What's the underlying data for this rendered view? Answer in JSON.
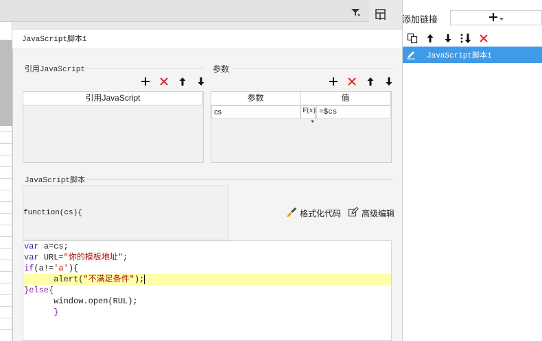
{
  "right_panel": {
    "title": "添加链接",
    "add_symbol": "+",
    "items": [
      {
        "label": "JavaScript脚本1",
        "selected": true
      }
    ]
  },
  "dialog": {
    "title": "JavaScript脚本1",
    "ref_section": {
      "label": "引用JavaScript",
      "columns": [
        "引用JavaScript"
      ]
    },
    "param_section": {
      "label": "参数",
      "columns": [
        "参数",
        "值"
      ],
      "rows": [
        {
          "name": "cs",
          "fx": "F(x)",
          "value": "=$cs"
        }
      ]
    },
    "script_section": {
      "label": "JavaScript脚本",
      "signature": "function(cs){",
      "format_label": "格式化代码",
      "advanced_label": "高级编辑"
    },
    "code_lines": [
      "var a=cs;",
      "var URL=\"你的模板地址\";",
      "if(a!='a'){",
      "      alert(\"不满足条件\");",
      "}else{",
      "      window.open(RUL);",
      "      }"
    ]
  },
  "colors": {
    "accent": "#3f9ae8",
    "delete": "#e03030",
    "highlight_line": "#ffffaa"
  }
}
